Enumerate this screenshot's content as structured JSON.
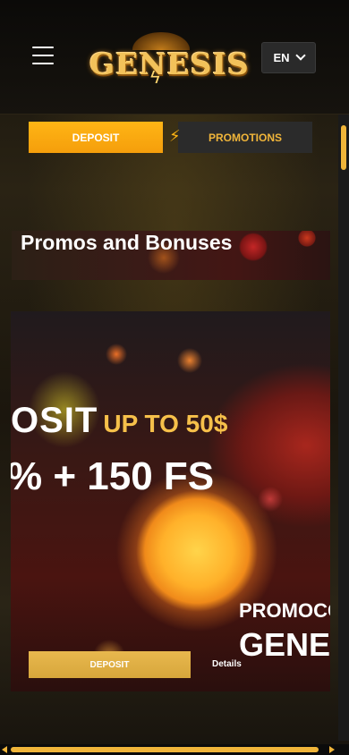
{
  "header": {
    "menu_icon": "hamburger-menu-icon",
    "logo_text": "GENESIS",
    "language": "EN",
    "language_icon": "chevron-down-icon"
  },
  "tabs": {
    "deposit_label": "DEPOSIT",
    "promotions_label": "PROMOTIONS",
    "promotions_icon": "lightning-bolt-icon",
    "active": "DEPOSIT"
  },
  "promos": {
    "title": "Promos and Bonuses"
  },
  "banner": {
    "line1_main": "OSIT",
    "line1_accent": "UP TO 50$",
    "line2": "% + 150 FS",
    "promo_label": "PROMOCC",
    "promo_code": "GENES",
    "deposit_button": "DEPOSIT",
    "details_link": "Details"
  },
  "colors": {
    "accent": "#F5A60B",
    "gold_text": "#F0B53A",
    "background": "#0F0D0A"
  }
}
